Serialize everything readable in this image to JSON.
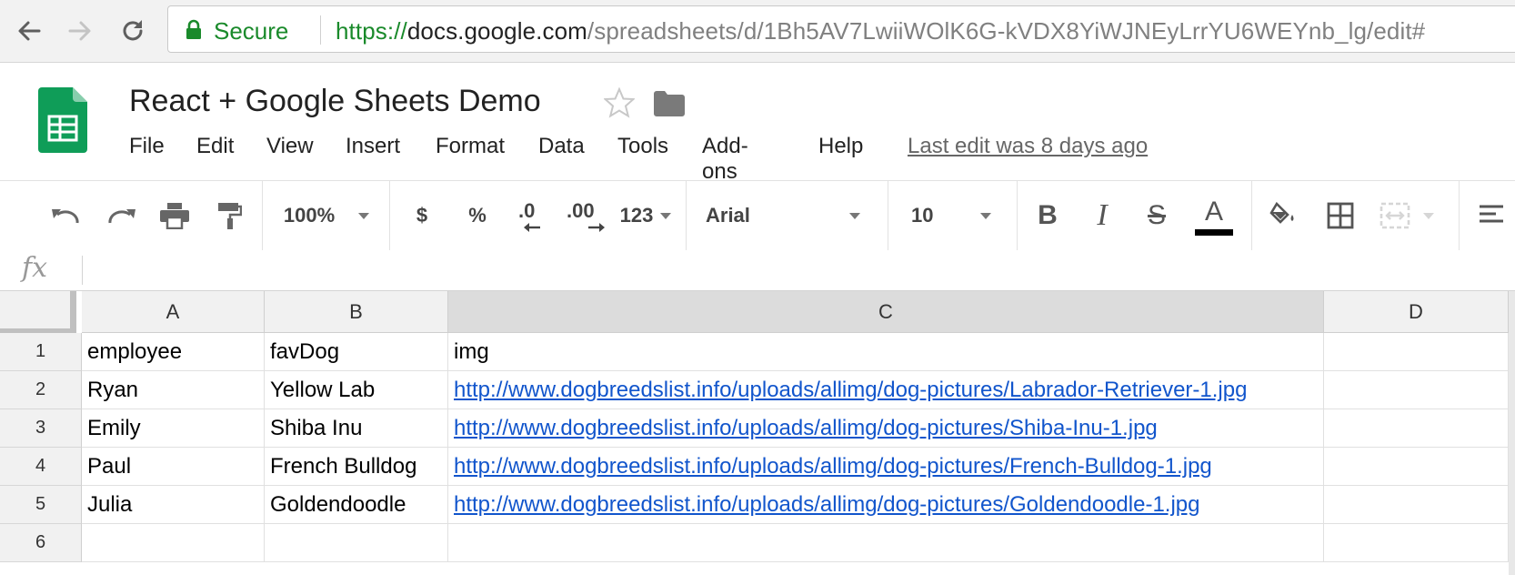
{
  "browser": {
    "secure_label": "Secure",
    "url_scheme": "https://",
    "url_host": "docs.google.com",
    "url_path": "/spreadsheets/d/1Bh5AV7LwiiWOlK6G-kVDX8YiWJNEyLrrYU6WEYnb_lg/edit#"
  },
  "document": {
    "title": "React + Google Sheets Demo",
    "last_edit": "Last edit was 8 days ago"
  },
  "menu": [
    "File",
    "Edit",
    "View",
    "Insert",
    "Format",
    "Data",
    "Tools",
    "Add-ons",
    "Help"
  ],
  "toolbar": {
    "zoom": "100%",
    "currency": "$",
    "percent": "%",
    "decrease_decimal": ".0",
    "increase_decimal": ".00",
    "more_formats": "123",
    "font": "Arial",
    "font_size": "10",
    "bold": "B",
    "italic": "I",
    "strikethrough": "S",
    "text_color": "A"
  },
  "formula_bar": {
    "fx_label": "fx",
    "value": ""
  },
  "sheet": {
    "columns": [
      "A",
      "B",
      "C",
      "D"
    ],
    "selected_column": "C",
    "row_numbers": [
      "1",
      "2",
      "3",
      "4",
      "5",
      "6"
    ],
    "rows": [
      [
        "employee",
        "favDog",
        "img",
        ""
      ],
      [
        "Ryan",
        "Yellow Lab",
        "http://www.dogbreedslist.info/uploads/allimg/dog-pictures/Labrador-Retriever-1.jpg",
        ""
      ],
      [
        "Emily",
        "Shiba Inu",
        "http://www.dogbreedslist.info/uploads/allimg/dog-pictures/Shiba-Inu-1.jpg",
        ""
      ],
      [
        "Paul",
        "French Bulldog",
        "http://www.dogbreedslist.info/uploads/allimg/dog-pictures/French-Bulldog-1.jpg",
        ""
      ],
      [
        "Julia",
        "Goldendoodle",
        "http://www.dogbreedslist.info/uploads/allimg/dog-pictures/Goldendoodle-1.jpg",
        ""
      ],
      [
        "",
        "",
        "",
        ""
      ]
    ]
  },
  "colors": {
    "secure_green": "#1a8a2b",
    "sheets_green": "#0f9d58",
    "link_blue": "#1155cc"
  }
}
